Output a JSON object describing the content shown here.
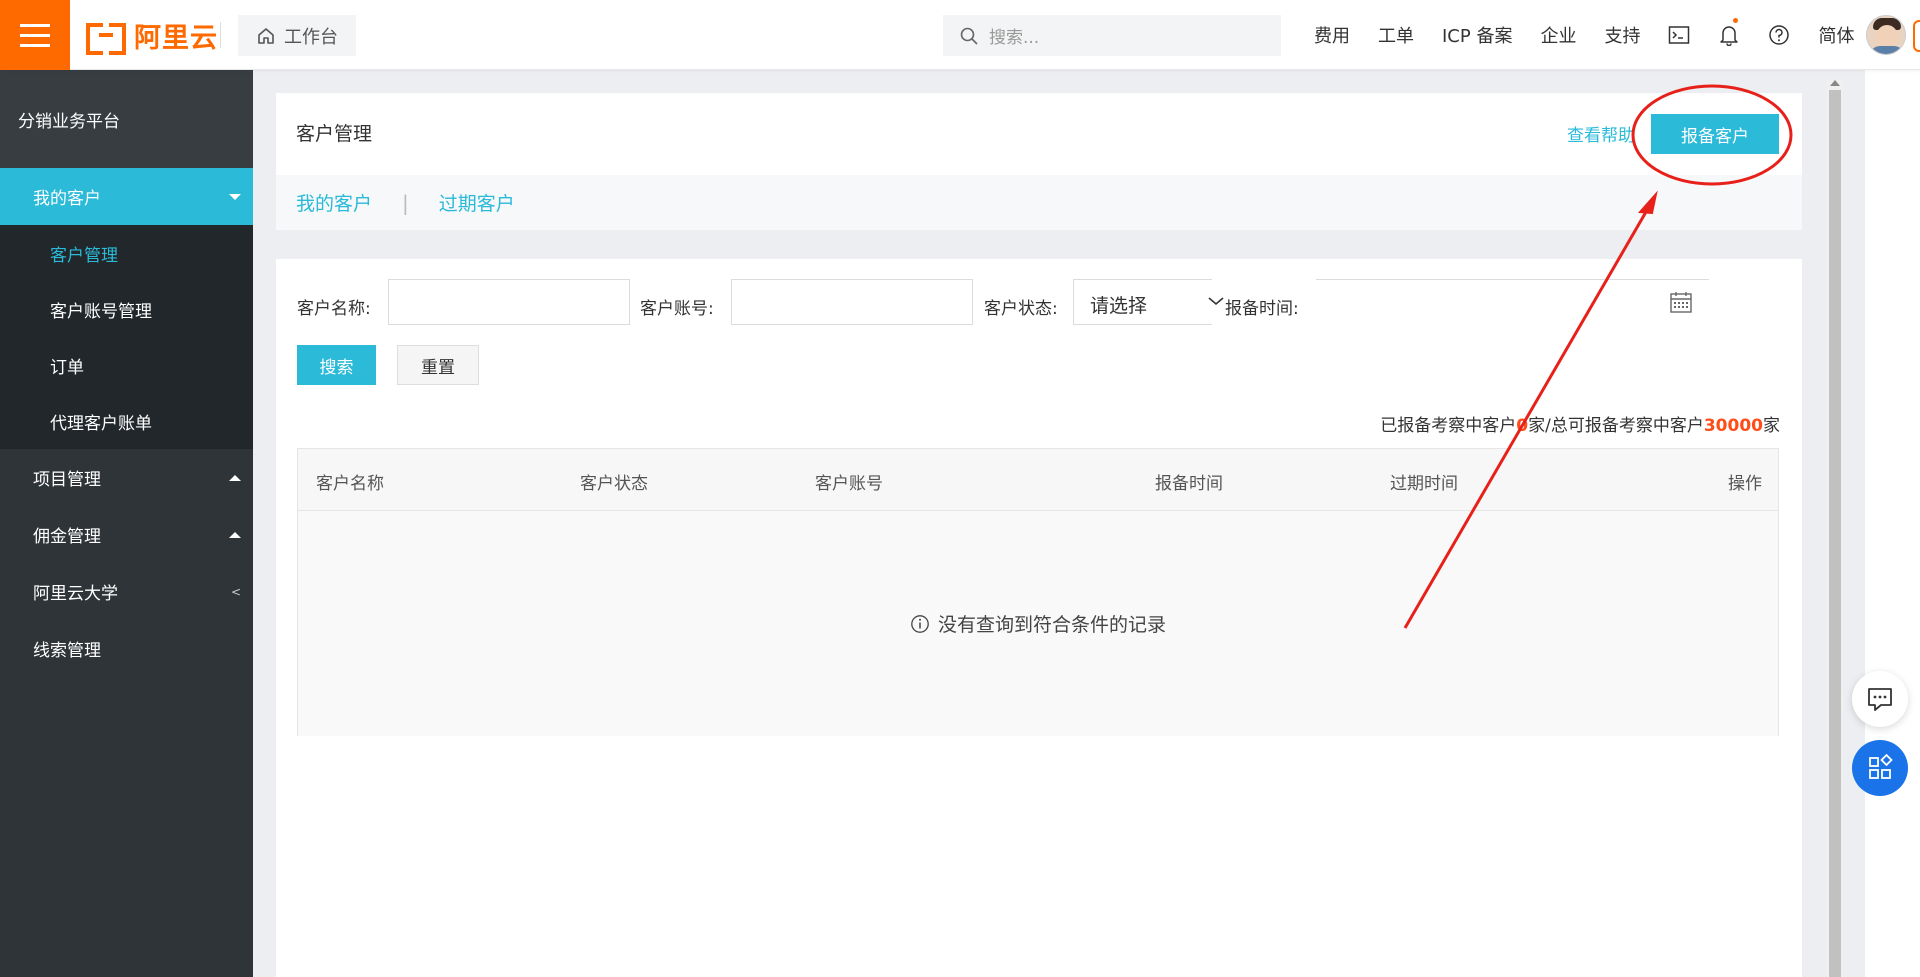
{
  "topbar": {
    "logo_text": "阿里云",
    "workbench_label": "工作台",
    "search_placeholder": "搜索...",
    "nav": [
      "费用",
      "工单",
      "ICP 备案",
      "企业",
      "支持"
    ],
    "lang_label": "简体"
  },
  "sidebar": {
    "title": "分销业务平台",
    "groups": [
      {
        "label": "我的客户",
        "items": [
          "客户管理",
          "客户账号管理",
          "订单",
          "代理客户账单"
        ]
      },
      {
        "label": "项目管理"
      },
      {
        "label": "佣金管理"
      },
      {
        "label": "阿里云大学"
      },
      {
        "label": "线索管理"
      }
    ]
  },
  "main": {
    "page_title": "客户管理",
    "help_link": "查看帮助",
    "report_button": "报备客户",
    "tabs": [
      "我的客户",
      "过期客户"
    ],
    "filters": {
      "name_label": "客户名称:",
      "account_label": "客户账号:",
      "status_label": "客户状态:",
      "status_value": "请选择",
      "time_label": "报备时间:"
    },
    "search_button": "搜索",
    "reset_button": "重置",
    "summary": {
      "prefix": "已报备考察中客户",
      "current": "0",
      "middle": "家/总可报备考察中客户",
      "total": "30000",
      "suffix": "家"
    },
    "table": {
      "columns": [
        "客户名称",
        "客户状态",
        "客户账号",
        "报备时间",
        "过期时间",
        "操作"
      ],
      "empty_text": "没有查询到符合条件的记录"
    }
  },
  "colors": {
    "brand": "#ff6a00",
    "accent": "#2bbad8",
    "annotation": "#e8201a",
    "sidebar_bg": "#2f3438"
  },
  "icons": [
    "menu-icon",
    "home-icon",
    "search-icon",
    "terminal-icon",
    "bell-icon",
    "help-icon",
    "calendar-icon",
    "info-icon",
    "chat-icon",
    "apps-icon"
  ]
}
